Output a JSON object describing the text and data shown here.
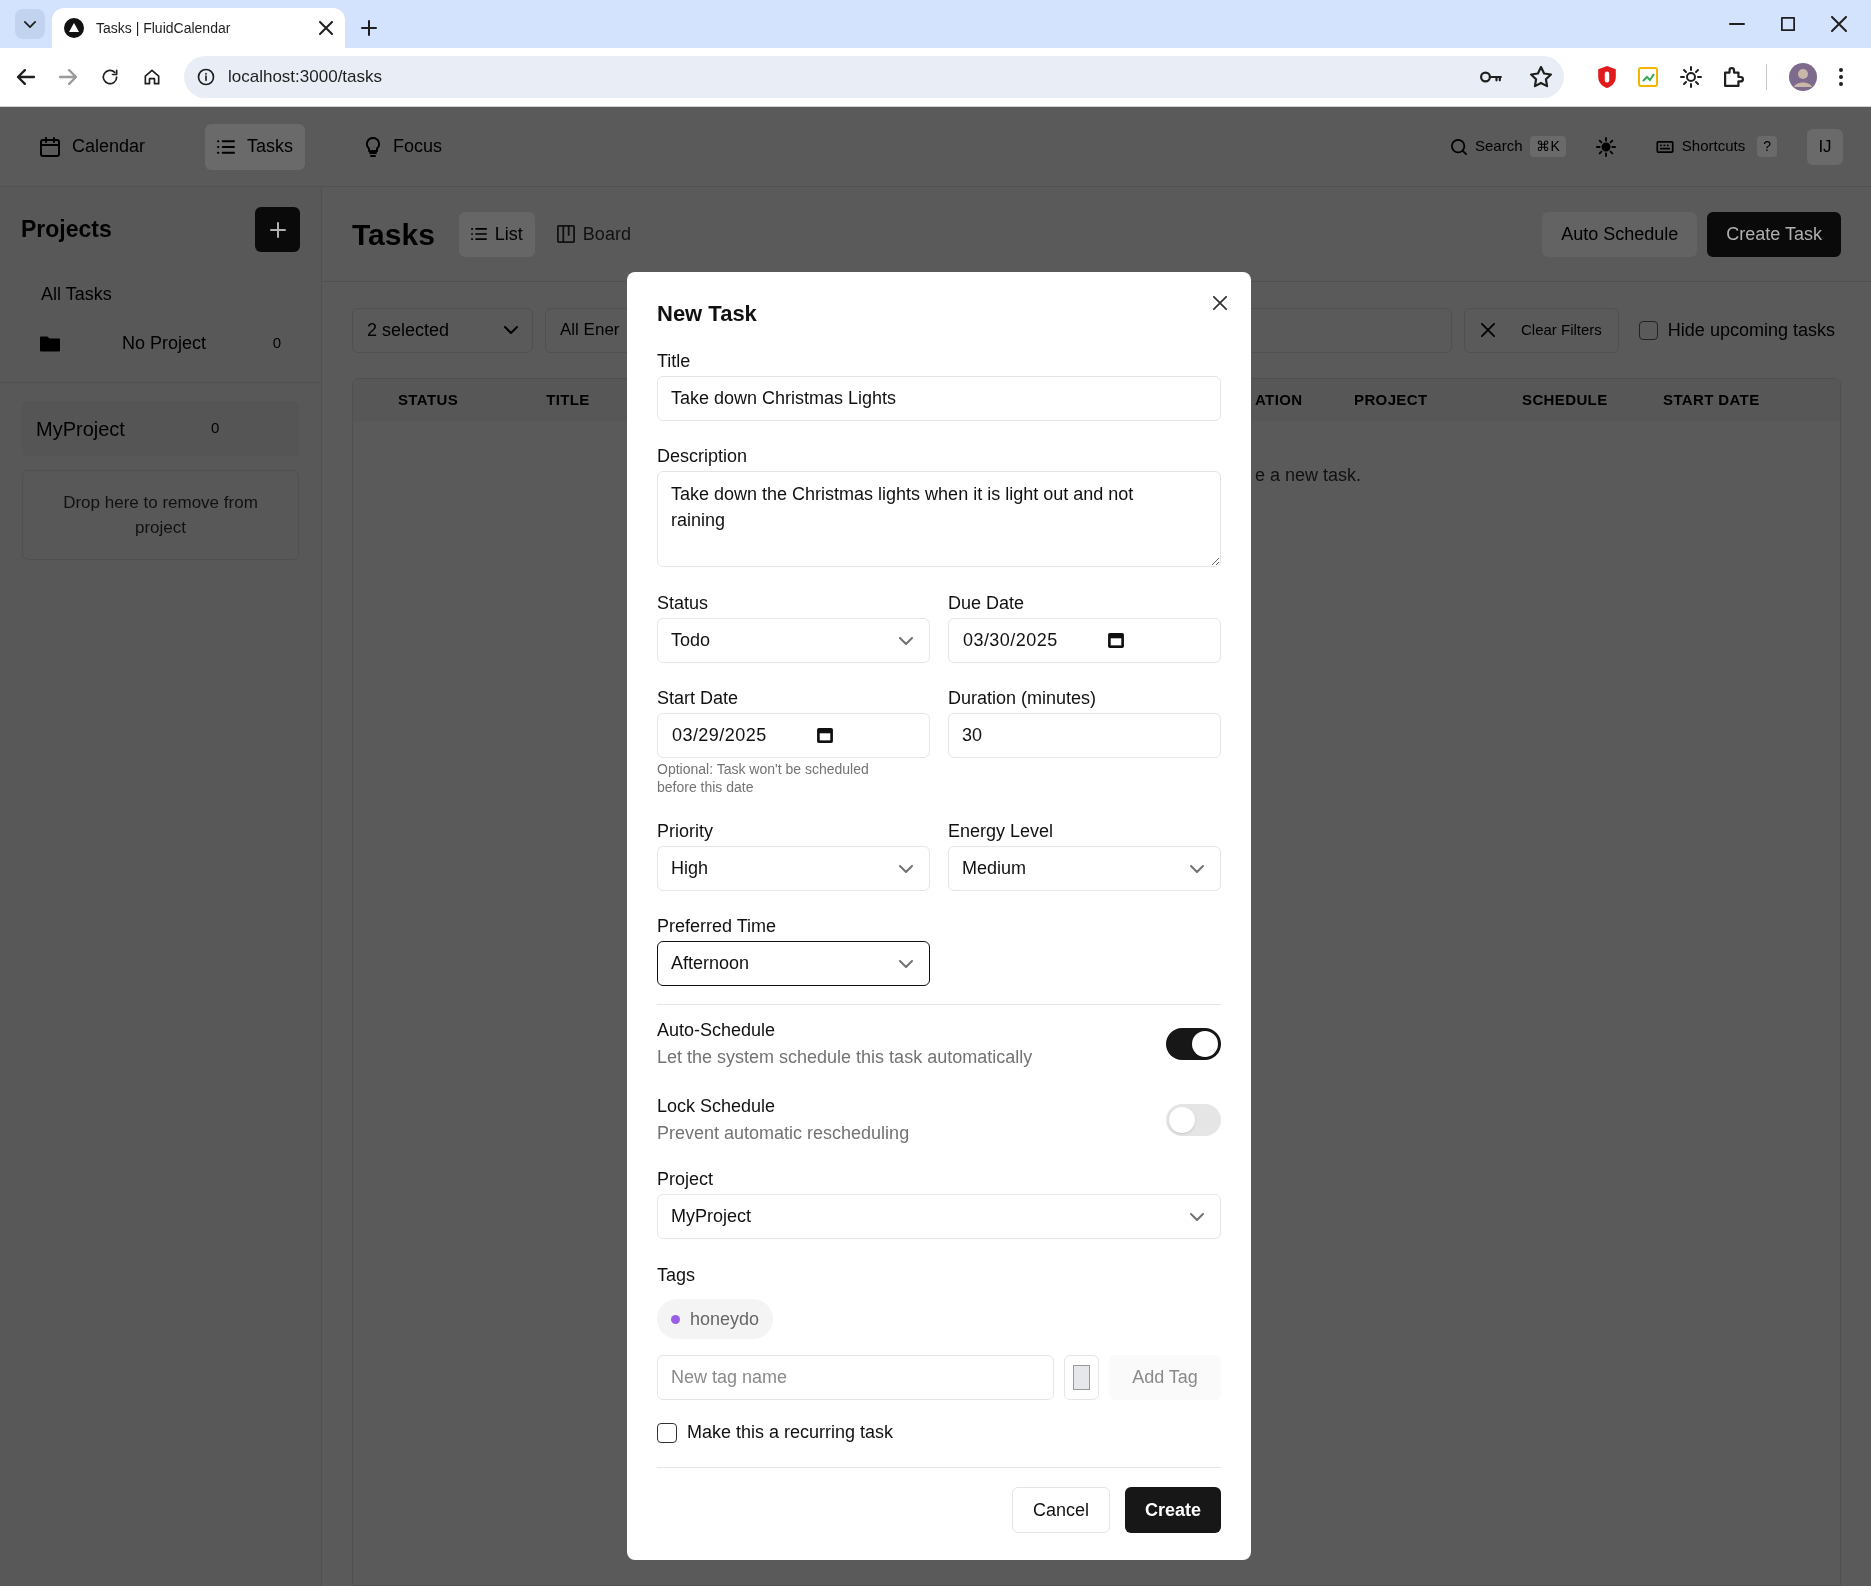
{
  "browser": {
    "tabs": [
      {
        "title": "Tasks | FluidCalendar",
        "selected": true
      }
    ],
    "address": "localhost:3000/tasks"
  },
  "app_header": {
    "nav": [
      {
        "label": "Calendar",
        "selected": false
      },
      {
        "label": "Tasks",
        "selected": true
      },
      {
        "label": "Focus",
        "selected": false
      }
    ],
    "search": {
      "placeholder": "Search",
      "shortcut": "⌘K"
    },
    "shortcuts": {
      "label": "Shortcuts",
      "key": "?"
    },
    "avatar": "IJ"
  },
  "sidebar": {
    "title": "Projects",
    "all_tasks": "All Tasks",
    "items": [
      {
        "name": "No Project",
        "count": "0",
        "kind": "none"
      },
      {
        "name": "MyProject",
        "count": "0",
        "kind": "project"
      }
    ],
    "drop_zone": "Drop here to remove from project"
  },
  "main": {
    "title": "Tasks",
    "views": [
      {
        "label": "List",
        "selected": true
      },
      {
        "label": "Board",
        "selected": false
      }
    ],
    "actions": [
      "Auto Schedule",
      "Create Task"
    ],
    "filters": {
      "status": "2 selected",
      "energy": "All Ener",
      "clear": "Clear Filters",
      "hide_upcoming": {
        "label": "Hide upcoming tasks",
        "checked": false
      }
    },
    "table": {
      "columns": [
        "STATUS",
        "TITLE",
        "ATION",
        "PROJECT",
        "SCHEDULE",
        "START DATE"
      ],
      "empty_message": "e a new task."
    }
  },
  "dialog": {
    "title": "New Task",
    "title_field": {
      "label": "Title",
      "value": "Take down Christmas Lights"
    },
    "description": {
      "label": "Description",
      "value": "Take down the Christmas lights when it is light out and not raining"
    },
    "status": {
      "label": "Status",
      "value": "Todo"
    },
    "due_date": {
      "label": "Due Date",
      "value": "03/30/2025"
    },
    "start_date": {
      "label": "Start Date",
      "value": "03/29/2025",
      "hint": "Optional: Task won't be scheduled before this date"
    },
    "duration": {
      "label": "Duration (minutes)",
      "value": "30"
    },
    "priority": {
      "label": "Priority",
      "value": "High"
    },
    "energy_level": {
      "label": "Energy Level",
      "value": "Medium"
    },
    "preferred_time": {
      "label": "Preferred Time",
      "value": "Afternoon",
      "focused": true
    },
    "toggles": [
      {
        "label": "Auto-Schedule",
        "description": "Let the system schedule this task automatically",
        "on": true
      },
      {
        "label": "Lock Schedule",
        "description": "Prevent automatic rescheduling",
        "on": false
      }
    ],
    "project": {
      "label": "Project",
      "value": "MyProject"
    },
    "tags": {
      "label": "Tags",
      "items": [
        {
          "name": "honeydo",
          "color": "#9b5de5"
        }
      ],
      "new_tag_placeholder": "New tag name",
      "add_button": "Add Tag"
    },
    "recurring": {
      "label": "Make this a recurring task",
      "checked": false
    },
    "buttons": [
      "Cancel",
      "Create"
    ]
  }
}
